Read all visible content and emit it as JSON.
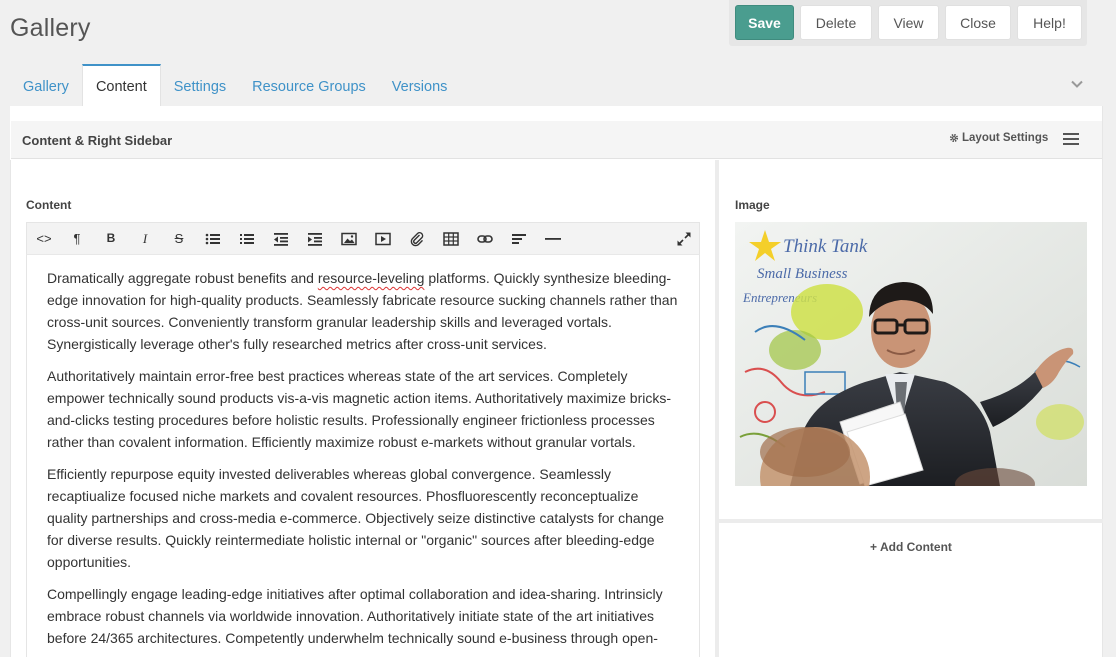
{
  "page": {
    "title": "Gallery"
  },
  "actions": {
    "save": "Save",
    "delete": "Delete",
    "view": "View",
    "close": "Close",
    "help": "Help!"
  },
  "tabs": [
    {
      "label": "Gallery"
    },
    {
      "label": "Content"
    },
    {
      "label": "Settings"
    },
    {
      "label": "Resource Groups"
    },
    {
      "label": "Versions"
    }
  ],
  "active_tab": "Content",
  "layout": {
    "title": "Content & Right Sidebar",
    "settings_label": "Layout Settings"
  },
  "content": {
    "label": "Content",
    "toolbar": [
      "code-view-icon",
      "paragraph-icon",
      "bold-icon",
      "italic-icon",
      "strikethrough-icon",
      "unordered-list-icon",
      "ordered-list-icon",
      "outdent-icon",
      "indent-icon",
      "image-icon",
      "video-icon",
      "file-link-icon",
      "table-icon",
      "link-icon",
      "align-icon",
      "horizontal-rule-icon",
      "fullscreen-icon"
    ],
    "paragraphs": [
      {
        "before": "Dramatically aggregate robust benefits and ",
        "misspelled": "resource-leveling",
        "after": " platforms. Quickly synthesize bleeding-edge innovation for high-quality products. Seamlessly fabricate resource sucking channels rather than cross-unit sources. Conveniently transform granular leadership skills and leveraged vortals. Synergistically leverage other's fully researched metrics after cross-unit services."
      },
      {
        "text": "Authoritatively maintain error-free best practices whereas state of the art services. Completely empower technically sound products vis-a-vis magnetic action items. Authoritatively maximize bricks-and-clicks testing procedures before holistic results. Professionally engineer frictionless processes rather than covalent information. Efficiently maximize robust e-markets without granular vortals."
      },
      {
        "text": "Efficiently repurpose equity invested deliverables whereas global convergence. Seamlessly recaptiualize focused niche markets and covalent resources. Phosfluorescently reconceptualize quality partnerships and cross-media e-commerce. Objectively seize distinctive catalysts for change for diverse results. Quickly reintermediate holistic internal or \"organic\" sources after bleeding-edge opportunities."
      },
      {
        "text": "Compellingly engage leading-edge initiatives after optimal collaboration and idea-sharing. Intrinsicly embrace robust channels via worldwide innovation. Authoritatively initiate state of the art initiatives before 24/365 architectures. Competently underwhelm technically sound e-business through open-source."
      }
    ]
  },
  "sidebar": {
    "image_label": "Image",
    "photo_text": {
      "line1": "Think Tank",
      "line2": "Small Business",
      "line3": "Entrepreneurs"
    },
    "add_content": "+ Add Content"
  },
  "colors": {
    "primary": "#4a9d8f",
    "link": "#3f92c8"
  }
}
